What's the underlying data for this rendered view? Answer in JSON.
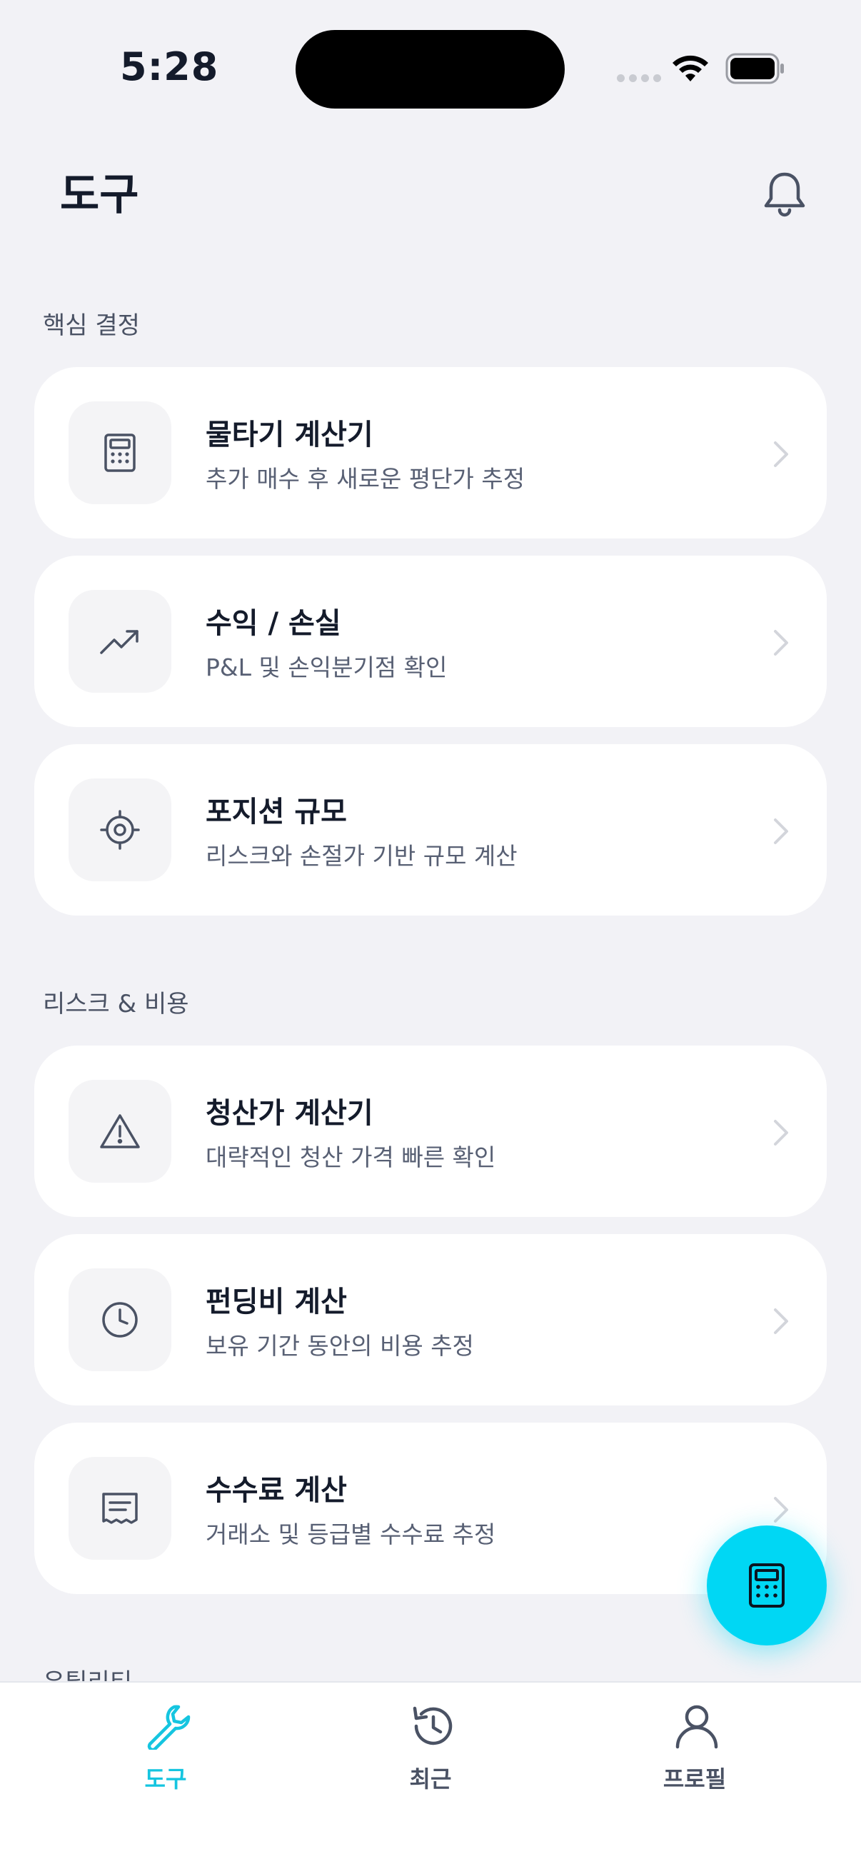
{
  "status_bar": {
    "time": "5:28"
  },
  "header": {
    "title": "도구"
  },
  "sections": [
    {
      "label": "핵심 결정",
      "items": [
        {
          "title": "물타기 계산기",
          "subtitle": "추가 매수 후 새로운 평단가 추정",
          "icon": "calculator-icon"
        },
        {
          "title": "수익 / 손실",
          "subtitle": "P&L 및 손익분기점 확인",
          "icon": "trending-up-icon"
        },
        {
          "title": "포지션 규모",
          "subtitle": "리스크와 손절가 기반 규모 계산",
          "icon": "crosshair-icon"
        }
      ]
    },
    {
      "label": "리스크 & 비용",
      "items": [
        {
          "title": "청산가 계산기",
          "subtitle": "대략적인 청산 가격 빠른 확인",
          "icon": "warning-triangle-icon"
        },
        {
          "title": "펀딩비 계산",
          "subtitle": "보유 기간 동안의 비용 추정",
          "icon": "clock-icon"
        },
        {
          "title": "수수료 계산",
          "subtitle": "거래소 및 등급별 수수료 추정",
          "icon": "receipt-icon"
        }
      ]
    },
    {
      "label": "유틸리티"
    }
  ],
  "tabbar": {
    "tabs": [
      {
        "label": "도구",
        "icon": "wrench-icon",
        "active": true
      },
      {
        "label": "최근",
        "icon": "history-icon",
        "active": false
      },
      {
        "label": "프로필",
        "icon": "user-icon",
        "active": false
      }
    ]
  },
  "colors": {
    "accent": "#00d7f4",
    "accent_text": "#15c5e0",
    "background": "#f2f2f6",
    "card": "#ffffff"
  }
}
